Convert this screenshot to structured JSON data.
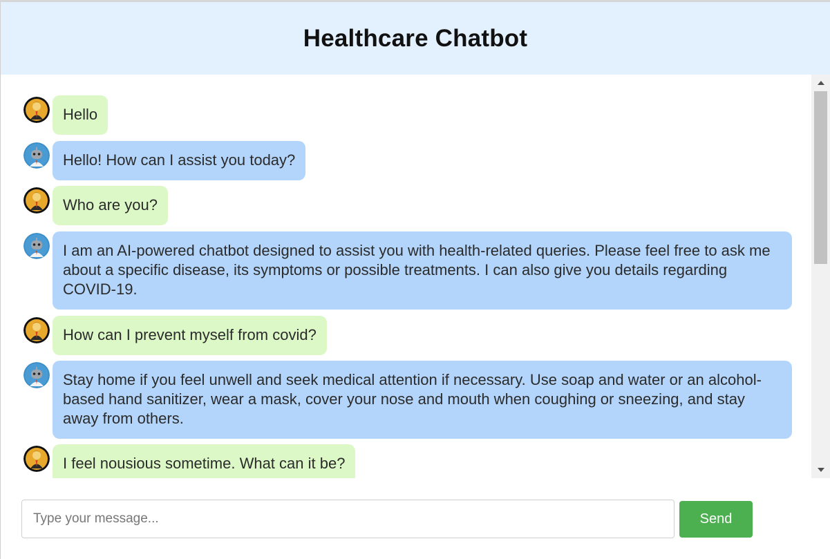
{
  "header": {
    "title": "Healthcare Chatbot"
  },
  "messages": [
    {
      "sender": "user",
      "text": "Hello"
    },
    {
      "sender": "bot",
      "text": "Hello! How can I assist you today?"
    },
    {
      "sender": "user",
      "text": "Who are you?"
    },
    {
      "sender": "bot",
      "text": "I am an AI-powered chatbot designed to assist you with health-related queries. Please feel free to ask me about a specific disease, its symptoms or possible treatments. I can also give you details regarding COVID-19."
    },
    {
      "sender": "user",
      "text": "How can I prevent myself from covid?"
    },
    {
      "sender": "bot",
      "text": "Stay home if you feel unwell and seek medical attention if necessary. Use soap and water or an alcohol-based hand sanitizer, wear a mask, cover your nose and mouth when coughing or sneezing, and stay away from others."
    },
    {
      "sender": "user",
      "text": "I feel nousious sometime. What can it be?"
    }
  ],
  "composer": {
    "placeholder": "Type your message...",
    "value": "",
    "send_label": "Send"
  },
  "icons": {
    "user_avatar": "user-avatar-icon",
    "bot_avatar": "robot-avatar-icon",
    "scroll_up": "scroll-up-arrow-icon",
    "scroll_down": "scroll-down-arrow-icon"
  },
  "colors": {
    "header_bg": "#e3f0fe",
    "user_bubble": "#dcf8c6",
    "bot_bubble": "#b3d5fb",
    "send_button": "#4caf50"
  }
}
